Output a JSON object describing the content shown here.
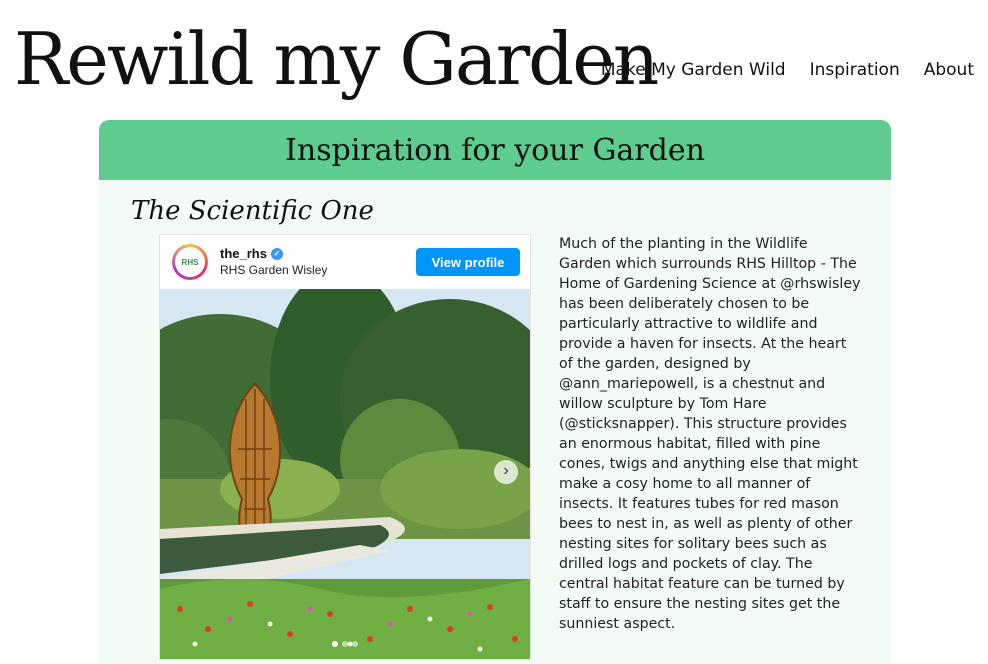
{
  "site": {
    "logo": "Rewild my Garden",
    "nav": [
      "Make My Garden Wild",
      "Inspiration",
      "About"
    ]
  },
  "page": {
    "heading": "Inspiration for your Garden",
    "section_title": "The Scientific One"
  },
  "instagram": {
    "username": "the_rhs",
    "location": "RHS Garden Wisley",
    "avatar_text": "RHS",
    "view_profile_label": "View profile",
    "next_icon": "›",
    "slide_count": 3,
    "active_slide": 1
  },
  "description": "Much of the planting in the Wildlife Garden which surrounds RHS Hilltop - The Home of Gardening Science at @rhswisley has been deliberately chosen to be particularly attractive to wildlife and provide a haven for insects. At the heart of the garden, designed by @ann_mariepowell, is a chestnut and willow sculpture by Tom Hare (@sticksnapper). This structure provides an enormous habitat, filled with pine cones, twigs and anything else that might make a cosy home to all manner of insects. It features tubes for red mason bees to nest in, as well as plenty of other nesting sites for solitary bees such as drilled logs and pockets of clay. The central habitat feature can be turned by staff to ensure the nesting sites get the sunniest aspect.",
  "colors": {
    "banner": "#5ecb8f",
    "content_bg": "#f3fbf6",
    "button": "#0095f6"
  }
}
